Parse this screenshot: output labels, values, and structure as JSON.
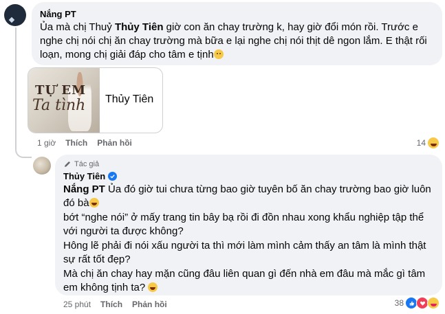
{
  "comment": {
    "author": "Nắng PT",
    "text": "Ủa mà chị Thuỷ Thủy Tiên giờ con ăn chay trường k, hay giờ đổi món rồi. Trước e nghe chị nói chị ăn chay trường mà bữa e lại nghe chị nói thịt dê ngon lắm. E thật rối loạn, mong chị giải đáp cho tâm e tịnh",
    "text_part1": "Ủa mà chị Thuỷ ",
    "text_mention": "Thủy Tiên",
    "text_part2": " giờ con ăn chay trường k, hay giờ đổi món rồi. Trước e nghe chị nói chị ăn chay trường mà bữa e lại nghe chị nói thịt dê ngon lắm. E thật rối loạn, mong chị giải đáp cho tâm e tịnh",
    "attachment": {
      "caption_top": "TỰ EM",
      "caption_bottom": "Ta tình",
      "label": "Thủy Tiên"
    },
    "time": "1 giờ",
    "like_label": "Thích",
    "reply_label": "Phản hồi",
    "reaction_count": "14",
    "reaction_icons": [
      "laugh-reaction"
    ]
  },
  "reply": {
    "role": "Tác giả",
    "author": "Thủy Tiên",
    "mention": "Nắng PT",
    "line1": " Ủa đó giờ tui chưa từng bao giờ tuyên bố ăn chay trường bao giờ luôn đó bà",
    "line2": "bớt “nghe nói” ở mấy trang tin bây bạ rồi đi đồn nhau xong khẩu nghiệp tập thể với người ta được không?",
    "line3": "Hông lẽ phải đi nói xấu người ta thì mới làm mình cảm thấy an tâm là mình thật sự rất tốt đẹp?",
    "line4": "Mà chị ăn chay hay mặn cũng đâu liên quan gì đến nhà em đâu mà mắc gì tâm em không tịnh ta?",
    "time": "25 phút",
    "like_label": "Thích",
    "reply_label": "Phản hồi",
    "reaction_count": "38",
    "reaction_icons": [
      "like-reaction",
      "love-reaction",
      "haha-reaction"
    ]
  },
  "colors": {
    "bubble": "#f0f2f5",
    "meta_text": "#65676b",
    "verified": "#1877f2",
    "like": "#1877f2",
    "love": "#f33e58"
  }
}
